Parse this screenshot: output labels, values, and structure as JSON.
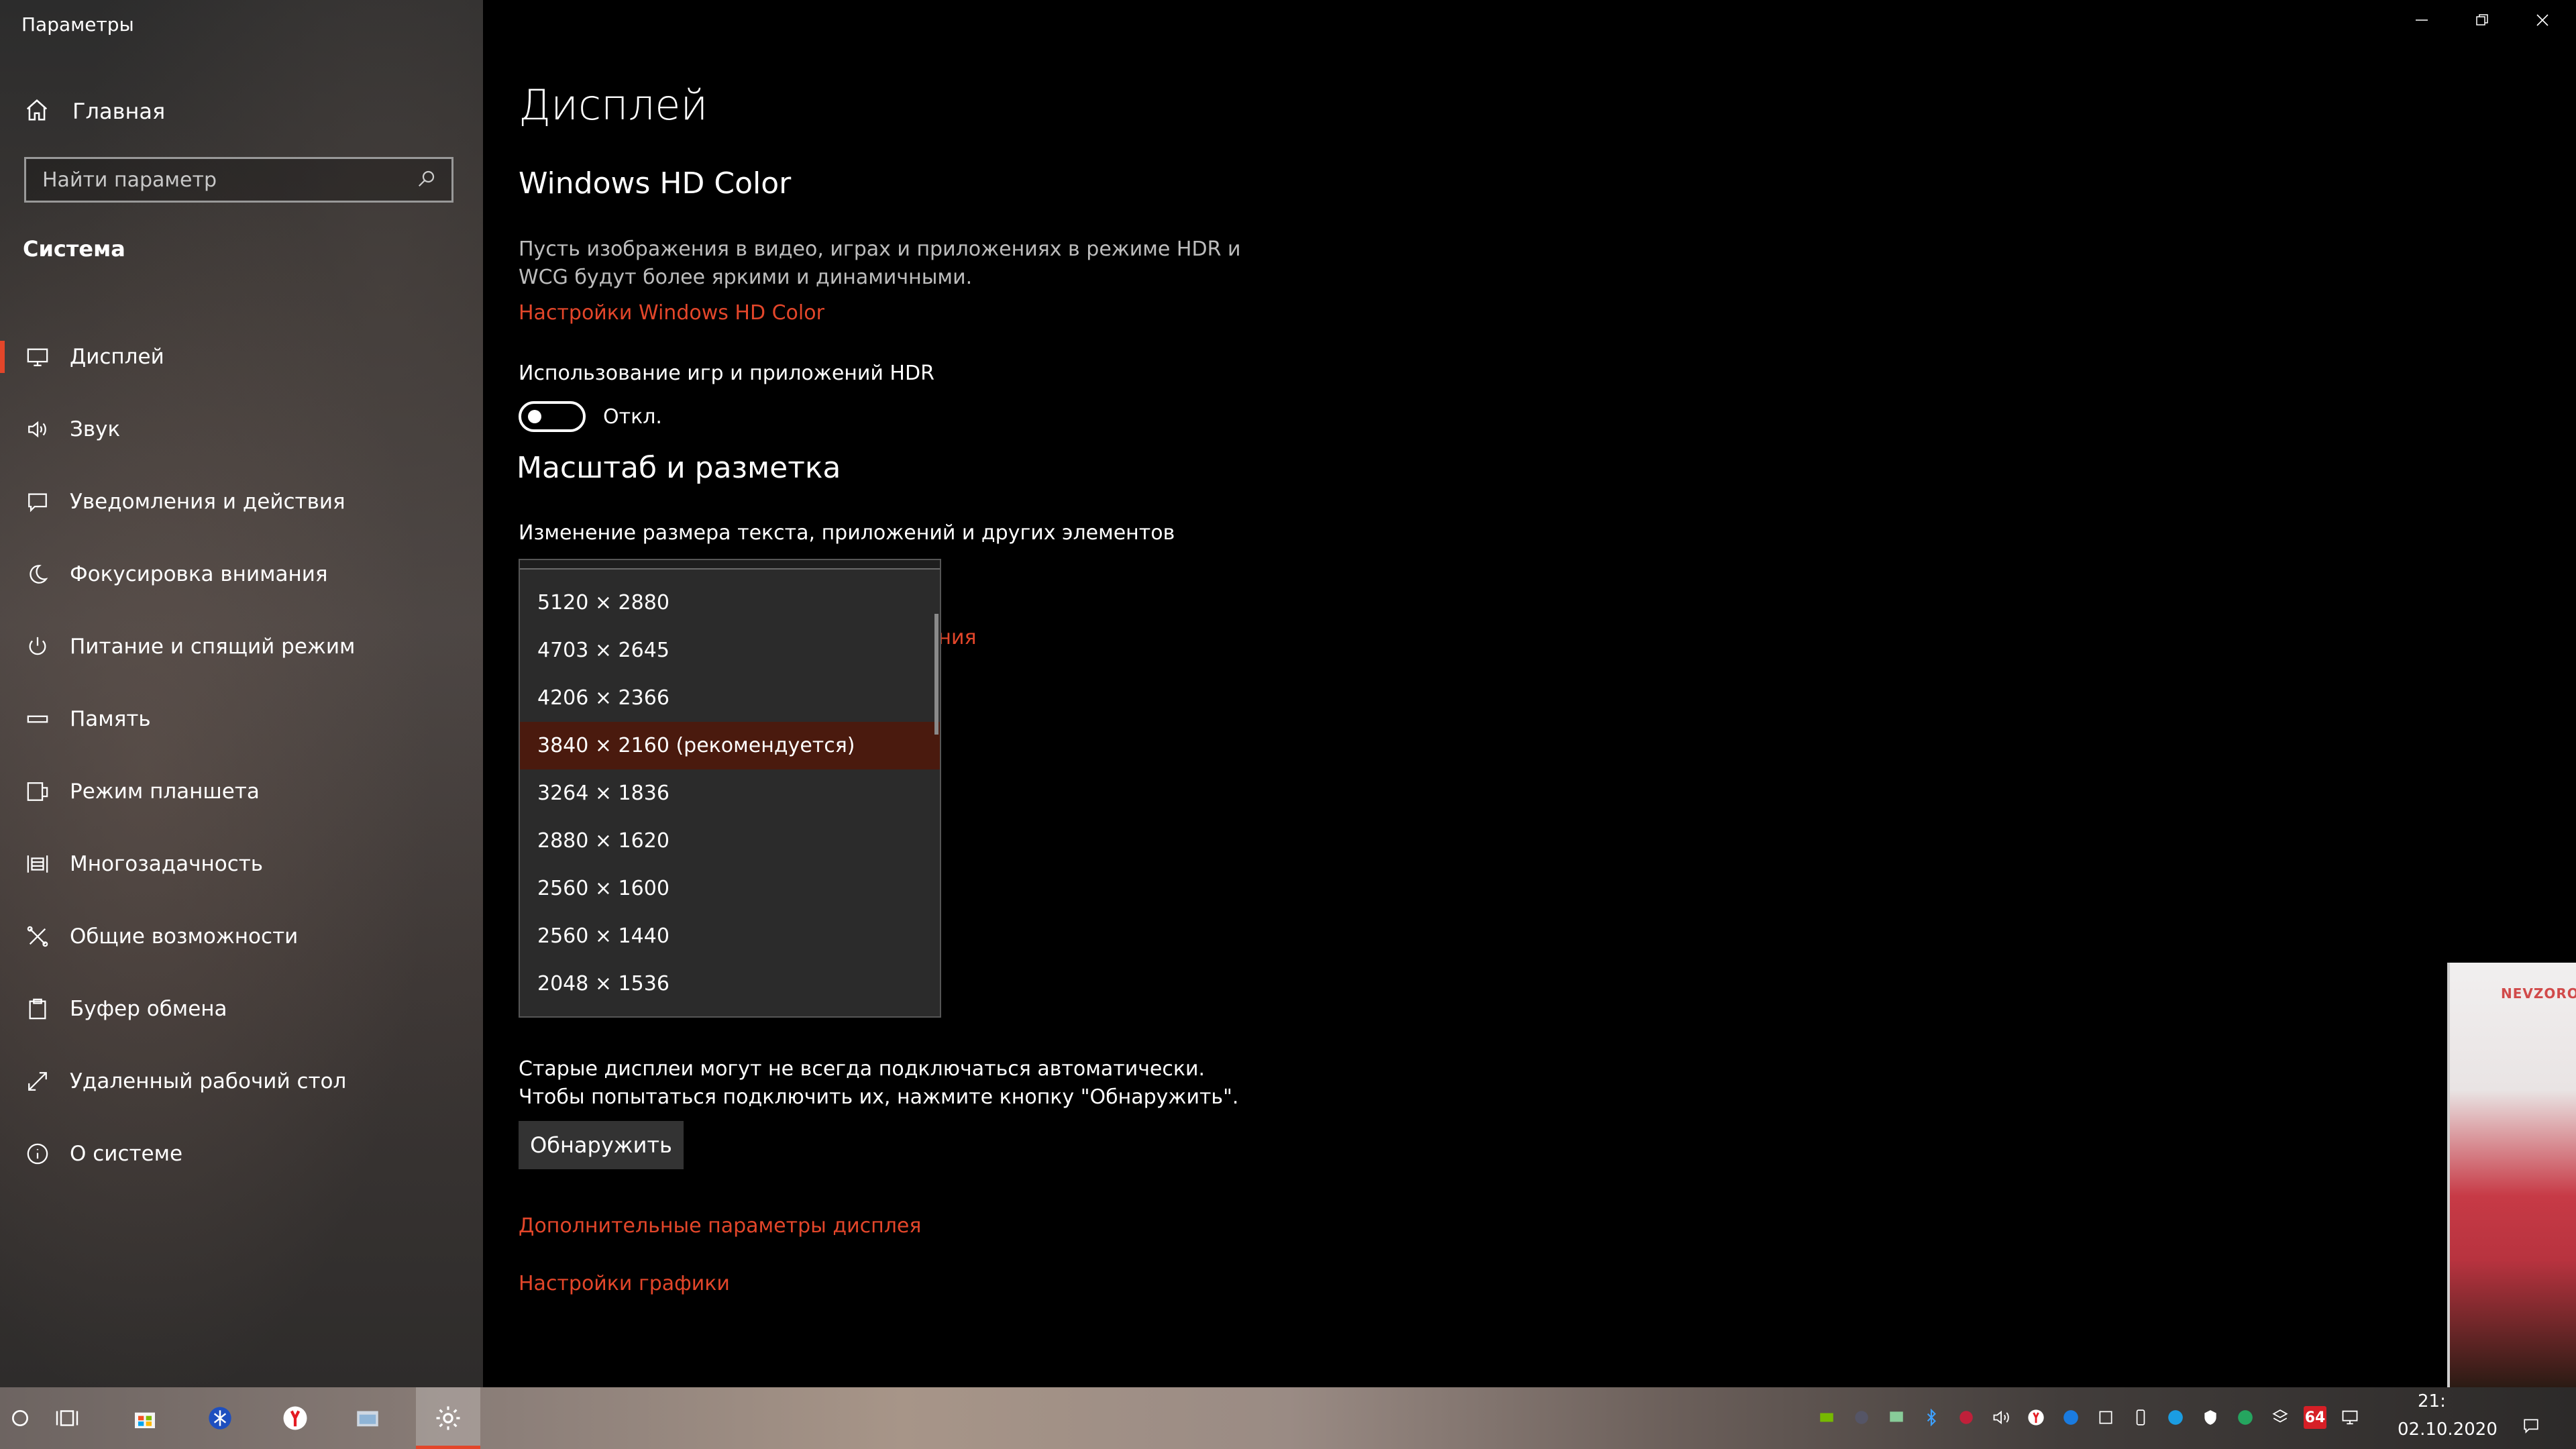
{
  "window": {
    "title": "Параметры",
    "controls": [
      "minimize-icon",
      "restore-icon",
      "close-icon"
    ]
  },
  "sidebar": {
    "home_label": "Главная",
    "search_placeholder": "Найти параметр",
    "section": "Система",
    "items": [
      {
        "label": "Дисплей",
        "icon": "monitor-icon",
        "active": true
      },
      {
        "label": "Звук",
        "icon": "speaker-icon"
      },
      {
        "label": "Уведомления и действия",
        "icon": "notification-icon"
      },
      {
        "label": "Фокусировка внимания",
        "icon": "moon-icon"
      },
      {
        "label": "Питание и спящий режим",
        "icon": "power-icon"
      },
      {
        "label": "Память",
        "icon": "storage-icon"
      },
      {
        "label": "Режим планшета",
        "icon": "tablet-icon"
      },
      {
        "label": "Многозадачность",
        "icon": "multitasking-icon"
      },
      {
        "label": "Общие возможности",
        "icon": "shared-experiences-icon"
      },
      {
        "label": "Буфер обмена",
        "icon": "clipboard-icon"
      },
      {
        "label": "Удаленный рабочий стол",
        "icon": "remote-desktop-icon"
      },
      {
        "label": "О системе",
        "icon": "info-icon"
      }
    ]
  },
  "main": {
    "title": "Дисплей",
    "hdr_heading": "Windows HD Color",
    "hdr_desc_line1": "Пусть изображения в видео, играх и приложениях в режиме HDR и",
    "hdr_desc_line2": "WCG будут более яркими и динамичными.",
    "hdr_link": "Настройки Windows HD Color",
    "hdr_toggle_label": "Использование игр и приложений HDR",
    "hdr_toggle_state": "Откл.",
    "scale_heading": "Масштаб и разметка",
    "scale_desc": "Изменение размера текста, приложений и других элементов",
    "hidden_link_fragment": "ания",
    "detect_text_line1": "Старые дисплеи могут не всегда подключаться автоматически.",
    "detect_text_line2": "Чтобы попытаться подключить их, нажмите кнопку \"Обнаружить\".",
    "detect_button": "Обнаружить",
    "advanced_link": "Дополнительные параметры дисплея",
    "graphics_link": "Настройки графики"
  },
  "resolution_dropdown": {
    "options": [
      "5120 × 2880",
      "4703 × 2645",
      "4206 × 2366",
      "3840 × 2160 (рекомендуется)",
      "3264 × 1836",
      "2880 × 1620",
      "2560 × 1600",
      "2560 × 1440",
      "2048 × 1536"
    ],
    "selected_index": 3
  },
  "preview": {
    "brand": "NEVZOROV"
  },
  "taskbar": {
    "tray_badge": "64",
    "time": "21:",
    "date": "02.10.2020"
  },
  "colors": {
    "accent": "#e3462a",
    "selected_option": "#4a1a0e",
    "background": "#000000",
    "dropdown_bg": "#2b2b2b"
  }
}
